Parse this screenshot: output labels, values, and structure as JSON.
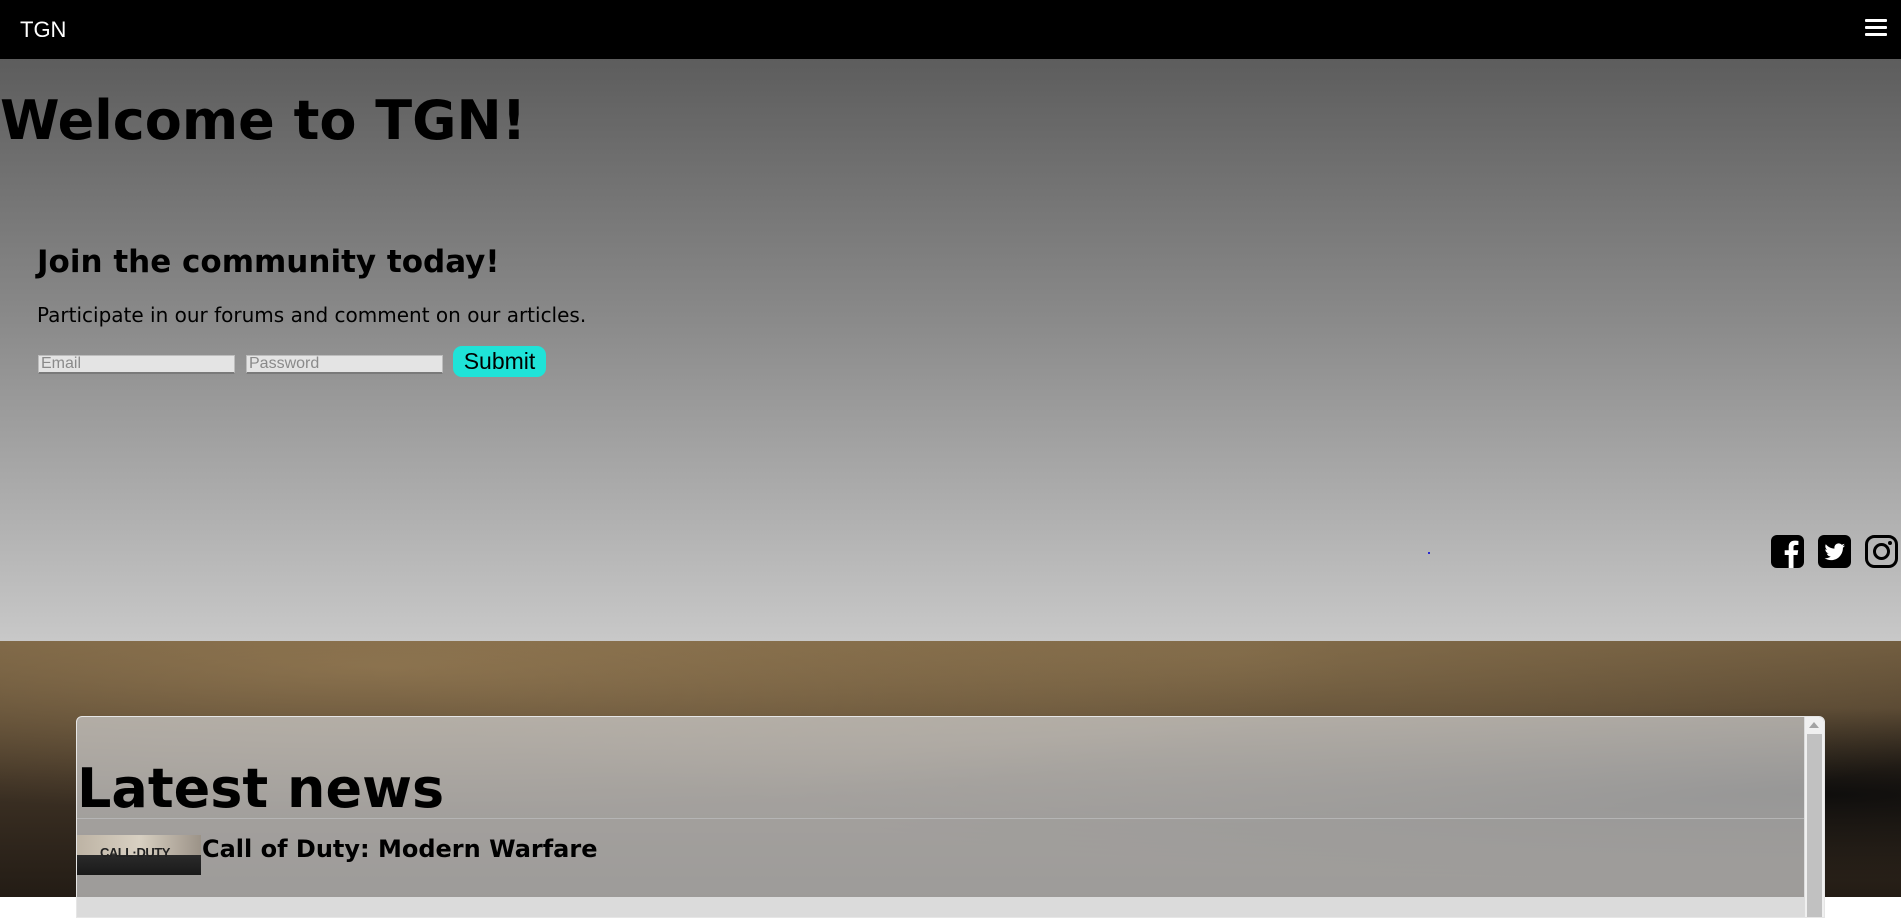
{
  "navbar": {
    "brand": "TGN",
    "menu_icon": "hamburger-menu-icon"
  },
  "hero": {
    "heading": "Welcome to TGN!",
    "join": {
      "heading": "Join the community today!",
      "description": "Participate in our forums and comment on our articles.",
      "email_placeholder": "Email",
      "password_placeholder": "Password",
      "submit_label": "Submit"
    },
    "social_icons": [
      "facebook-icon",
      "twitter-icon",
      "instagram-icon"
    ]
  },
  "news": {
    "heading": "Latest news",
    "items": [
      {
        "title": "Call of Duty: Modern Warfare",
        "thumbnail_text": "CALL·DUTY"
      }
    ]
  },
  "colors": {
    "navbar_bg": "#000000",
    "submit_bg": "#1fe3d8"
  }
}
